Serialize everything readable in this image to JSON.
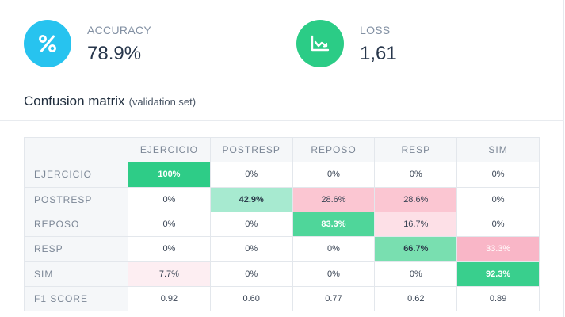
{
  "metrics": {
    "accuracy": {
      "label": "ACCURACY",
      "value": "78.9%",
      "icon": "percent-icon",
      "color": "#27c3ef"
    },
    "loss": {
      "label": "LOSS",
      "value": "1,61",
      "icon": "trending-chart-icon",
      "color": "#2bcc86"
    }
  },
  "matrix_title": "Confusion matrix",
  "matrix_subtitle": "(validation set)",
  "matrix": {
    "columns": [
      "EJERCICIO",
      "POSTRESP",
      "REPOSO",
      "RESP",
      "SIM"
    ],
    "rows": [
      {
        "label": "EJERCICIO",
        "cells": [
          {
            "text": "100%",
            "bg": "#2ecc87",
            "fg": "#ffffff",
            "bold": true
          },
          {
            "text": "0%",
            "bg": "#ffffff",
            "fg": "#3a4555",
            "bold": false
          },
          {
            "text": "0%",
            "bg": "#ffffff",
            "fg": "#3a4555",
            "bold": false
          },
          {
            "text": "0%",
            "bg": "#ffffff",
            "fg": "#3a4555",
            "bold": false
          },
          {
            "text": "0%",
            "bg": "#ffffff",
            "fg": "#3a4555",
            "bold": false
          }
        ]
      },
      {
        "label": "POSTRESP",
        "cells": [
          {
            "text": "0%",
            "bg": "#ffffff",
            "fg": "#3a4555",
            "bold": false
          },
          {
            "text": "42.9%",
            "bg": "#a7ead0",
            "fg": "#2b3a4a",
            "bold": true
          },
          {
            "text": "28.6%",
            "bg": "#fbc6d2",
            "fg": "#3a4555",
            "bold": false
          },
          {
            "text": "28.6%",
            "bg": "#fbc6d2",
            "fg": "#3a4555",
            "bold": false
          },
          {
            "text": "0%",
            "bg": "#ffffff",
            "fg": "#3a4555",
            "bold": false
          }
        ]
      },
      {
        "label": "REPOSO",
        "cells": [
          {
            "text": "0%",
            "bg": "#ffffff",
            "fg": "#3a4555",
            "bold": false
          },
          {
            "text": "0%",
            "bg": "#ffffff",
            "fg": "#3a4555",
            "bold": false
          },
          {
            "text": "83.3%",
            "bg": "#4fd69a",
            "fg": "#ffffff",
            "bold": true
          },
          {
            "text": "16.7%",
            "bg": "#fde0e7",
            "fg": "#3a4555",
            "bold": false
          },
          {
            "text": "0%",
            "bg": "#ffffff",
            "fg": "#3a4555",
            "bold": false
          }
        ]
      },
      {
        "label": "RESP",
        "cells": [
          {
            "text": "0%",
            "bg": "#ffffff",
            "fg": "#3a4555",
            "bold": false
          },
          {
            "text": "0%",
            "bg": "#ffffff",
            "fg": "#3a4555",
            "bold": false
          },
          {
            "text": "0%",
            "bg": "#ffffff",
            "fg": "#3a4555",
            "bold": false
          },
          {
            "text": "66.7%",
            "bg": "#79dfb0",
            "fg": "#2b3a4a",
            "bold": true
          },
          {
            "text": "33.3%",
            "bg": "#f9b6c7",
            "fg": "#ffffff",
            "bold": false
          }
        ]
      },
      {
        "label": "SIM",
        "cells": [
          {
            "text": "7.7%",
            "bg": "#fdeef2",
            "fg": "#3a4555",
            "bold": false
          },
          {
            "text": "0%",
            "bg": "#ffffff",
            "fg": "#3a4555",
            "bold": false
          },
          {
            "text": "0%",
            "bg": "#ffffff",
            "fg": "#3a4555",
            "bold": false
          },
          {
            "text": "0%",
            "bg": "#ffffff",
            "fg": "#3a4555",
            "bold": false
          },
          {
            "text": "92.3%",
            "bg": "#39cf8d",
            "fg": "#ffffff",
            "bold": true
          }
        ]
      }
    ],
    "f1": {
      "label": "F1 SCORE",
      "values": [
        "0.92",
        "0.60",
        "0.77",
        "0.62",
        "0.89"
      ]
    }
  }
}
